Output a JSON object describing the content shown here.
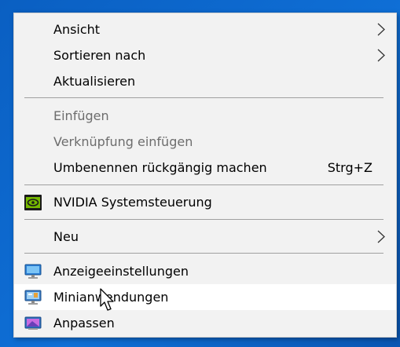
{
  "context_menu": {
    "items": [
      {
        "label": "Ansicht",
        "submenu": true
      },
      {
        "label": "Sortieren nach",
        "submenu": true
      },
      {
        "label": "Aktualisieren"
      },
      {
        "label": "Einfügen",
        "disabled": true
      },
      {
        "label": "Verknüpfung einfügen",
        "disabled": true
      },
      {
        "label": "Umbenennen rückgängig machen",
        "shortcut": "Strg+Z"
      },
      {
        "label": "NVIDIA Systemsteuerung",
        "icon": "nvidia-icon"
      },
      {
        "label": "Neu",
        "submenu": true
      },
      {
        "label": "Anzeigeeinstellungen",
        "icon": "display-settings-icon"
      },
      {
        "label": "Minianwendungen",
        "icon": "gadgets-icon",
        "highlighted": true
      },
      {
        "label": "Anpassen",
        "icon": "personalize-icon"
      }
    ]
  },
  "colors": {
    "desktop": "#0b63c6",
    "menu_background": "#f2f2f2",
    "hover_background": "#ffffff",
    "disabled_text": "#6d6d6d",
    "nvidia_green": "#76b900"
  }
}
